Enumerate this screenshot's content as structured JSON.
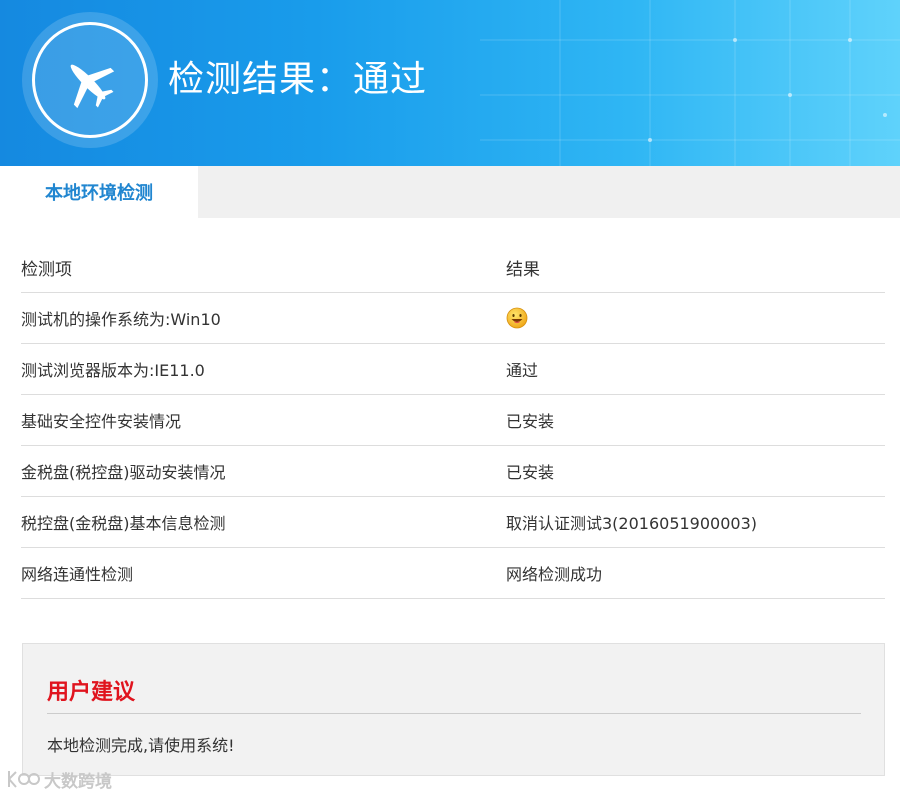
{
  "header": {
    "title": "检测结果：通过",
    "logo_icon": "airplane-icon",
    "colors": {
      "start": "#1589e0",
      "end": "#5fd2fb"
    }
  },
  "tabs": [
    {
      "label": "本地环境检测",
      "active": true
    }
  ],
  "table": {
    "headers": {
      "item": "检测项",
      "result": "结果"
    },
    "rows": [
      {
        "item": "测试机的操作系统为:Win10",
        "result": "",
        "result_icon": "smiley-icon"
      },
      {
        "item": "测试浏览器版本为:IE11.0",
        "result": "通过"
      },
      {
        "item": "基础安全控件安装情况",
        "result": "已安装"
      },
      {
        "item": "金税盘(税控盘)驱动安装情况",
        "result": "已安装"
      },
      {
        "item": "税控盘(金税盘)基本信息检测",
        "result": "取消认证测试3(2016051900003)"
      },
      {
        "item": "网络连通性检测",
        "result": "网络检测成功"
      }
    ]
  },
  "advice": {
    "title": "用户建议",
    "text": "本地检测完成,请使用系统!",
    "title_color": "#e0141e"
  },
  "watermark": {
    "text": "大数跨境"
  }
}
